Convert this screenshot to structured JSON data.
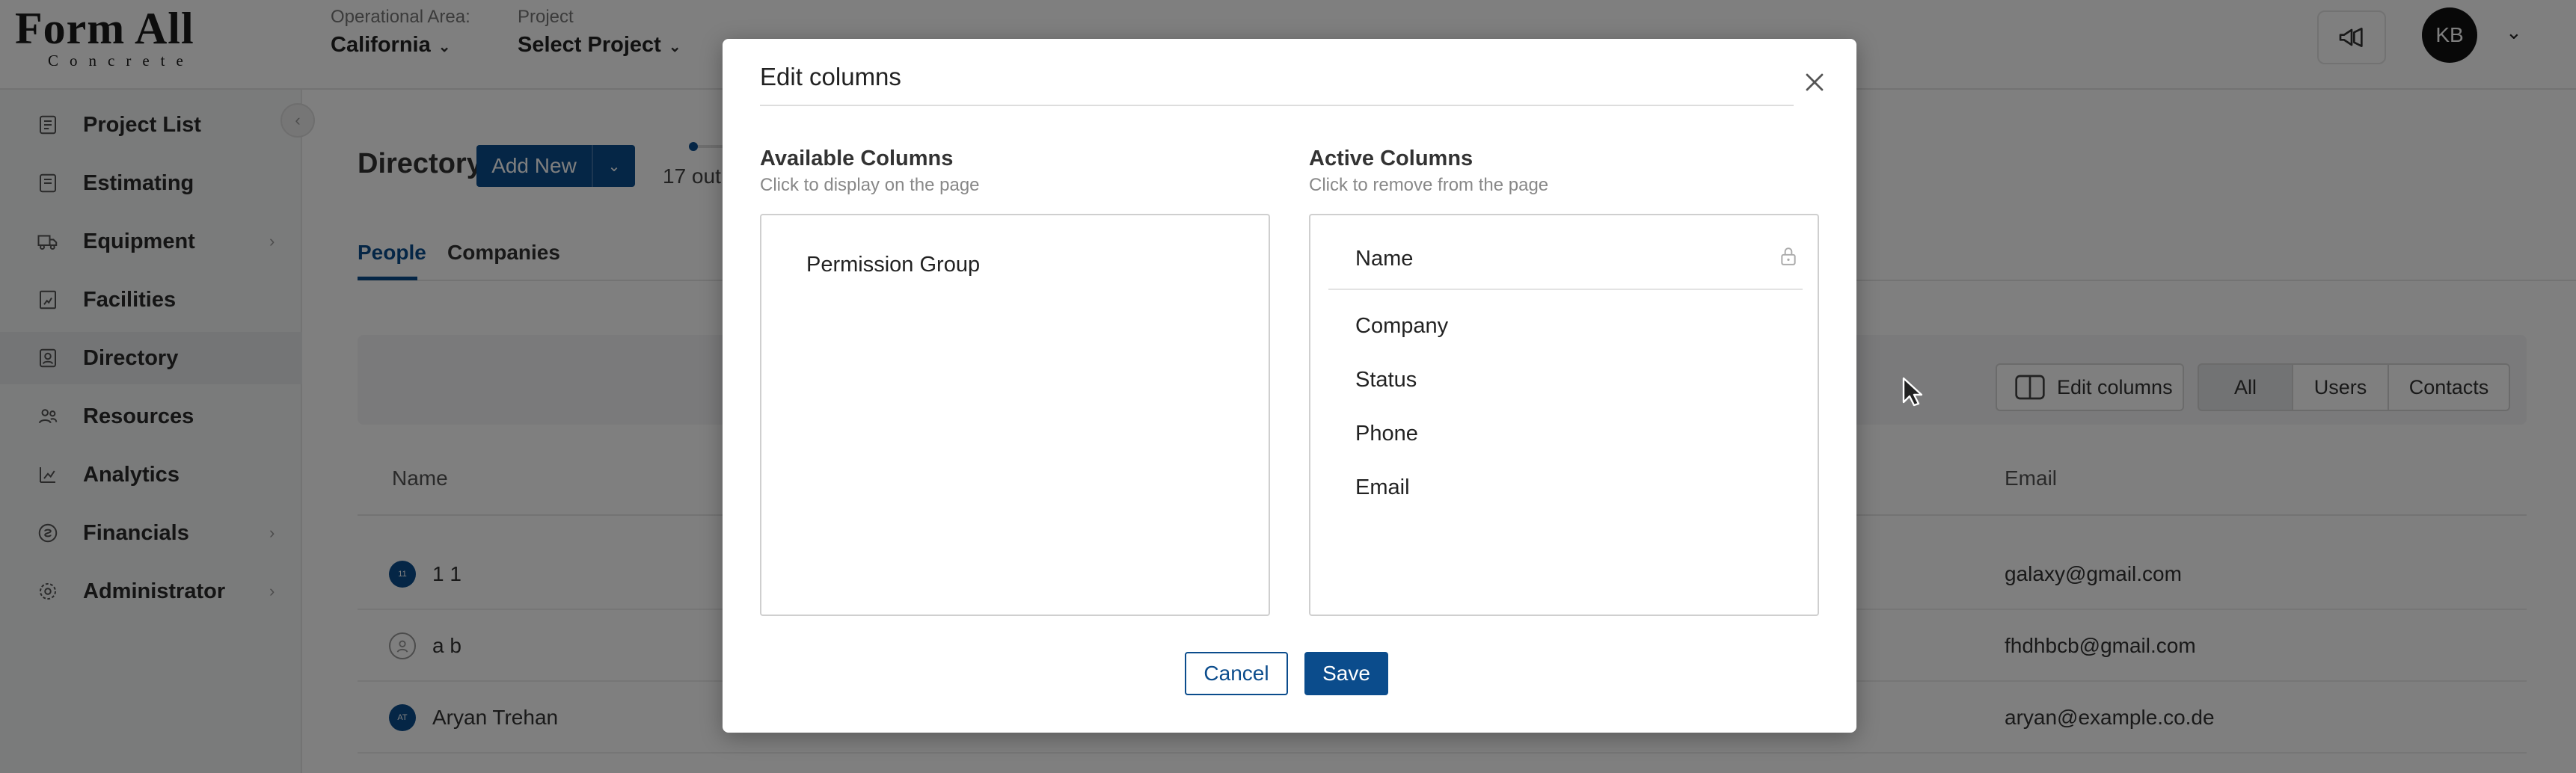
{
  "header": {
    "logo_main": "Form All",
    "logo_sub": "Concrete",
    "operational_area_label": "Operational Area:",
    "operational_area_value": "California",
    "project_label": "Project",
    "project_value": "Select Project",
    "user_initials": "KB"
  },
  "sidebar": {
    "items": [
      {
        "label": "Project List",
        "icon": "list-icon"
      },
      {
        "label": "Estimating",
        "icon": "estimate-icon"
      },
      {
        "label": "Equipment",
        "icon": "truck-icon"
      },
      {
        "label": "Facilities",
        "icon": "facility-icon"
      },
      {
        "label": "Directory",
        "icon": "directory-icon"
      },
      {
        "label": "Resources",
        "icon": "people-icon"
      },
      {
        "label": "Analytics",
        "icon": "chart-icon"
      },
      {
        "label": "Financials",
        "icon": "money-icon"
      },
      {
        "label": "Administrator",
        "icon": "gear-icon"
      }
    ]
  },
  "main": {
    "title": "Directory",
    "add_new_label": "Add New",
    "progress_text": "17 out",
    "tabs": [
      "People",
      "Companies"
    ],
    "edit_columns_label": "Edit columns",
    "filters": [
      "All",
      "Users",
      "Contacts"
    ],
    "table": {
      "headers": [
        "Name",
        "Email"
      ],
      "rows": [
        {
          "initials": "11",
          "name": "1 1",
          "email": "galaxy@gmail.com"
        },
        {
          "initials": "",
          "name": "a b",
          "email": "fhdhbcb@gmail.com"
        },
        {
          "initials": "AT",
          "name": "Aryan Trehan",
          "email": "aryan@example.co.de"
        }
      ]
    }
  },
  "modal": {
    "title": "Edit columns",
    "available": {
      "title": "Available Columns",
      "subtitle": "Click to display on the page",
      "items": [
        "Permission Group"
      ]
    },
    "active": {
      "title": "Active Columns",
      "subtitle": "Click to remove from the page",
      "locked_item": "Name",
      "items": [
        "Company",
        "Status",
        "Phone",
        "Email"
      ]
    },
    "cancel_label": "Cancel",
    "save_label": "Save"
  }
}
